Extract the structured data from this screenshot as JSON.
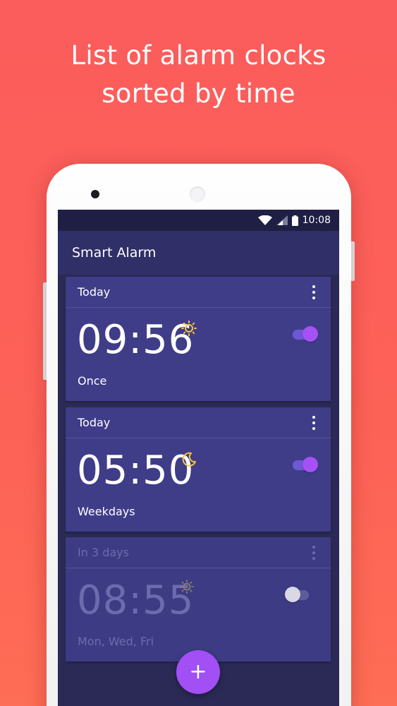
{
  "headline": {
    "line1": "List of alarm clocks",
    "line2": "sorted by time"
  },
  "status_bar": {
    "time": "10:08",
    "icons": [
      "wifi-icon",
      "cellular-signal-icon",
      "battery-icon"
    ]
  },
  "app_bar": {
    "title": "Smart Alarm"
  },
  "alarms": [
    {
      "day": "Today",
      "time": "09:56",
      "repeat": "Once",
      "daytime_icon": "sun-icon",
      "enabled": true
    },
    {
      "day": "Today",
      "time": "05:50",
      "repeat": "Weekdays",
      "daytime_icon": "moon-icon",
      "enabled": true
    },
    {
      "day": "In 3 days",
      "time": "08:55",
      "repeat": "Mon, Wed, Fri",
      "daytime_icon": "sun-icon",
      "enabled": false
    }
  ],
  "fab": {
    "label": "+",
    "icon": "plus-icon"
  },
  "colors": {
    "background": "#fb5c5c",
    "screen": "#2b2a56",
    "app_bar": "#312f67",
    "card": "#3f3d88",
    "accent": "#a24ff6",
    "icon_yellow": "#f5c542"
  }
}
